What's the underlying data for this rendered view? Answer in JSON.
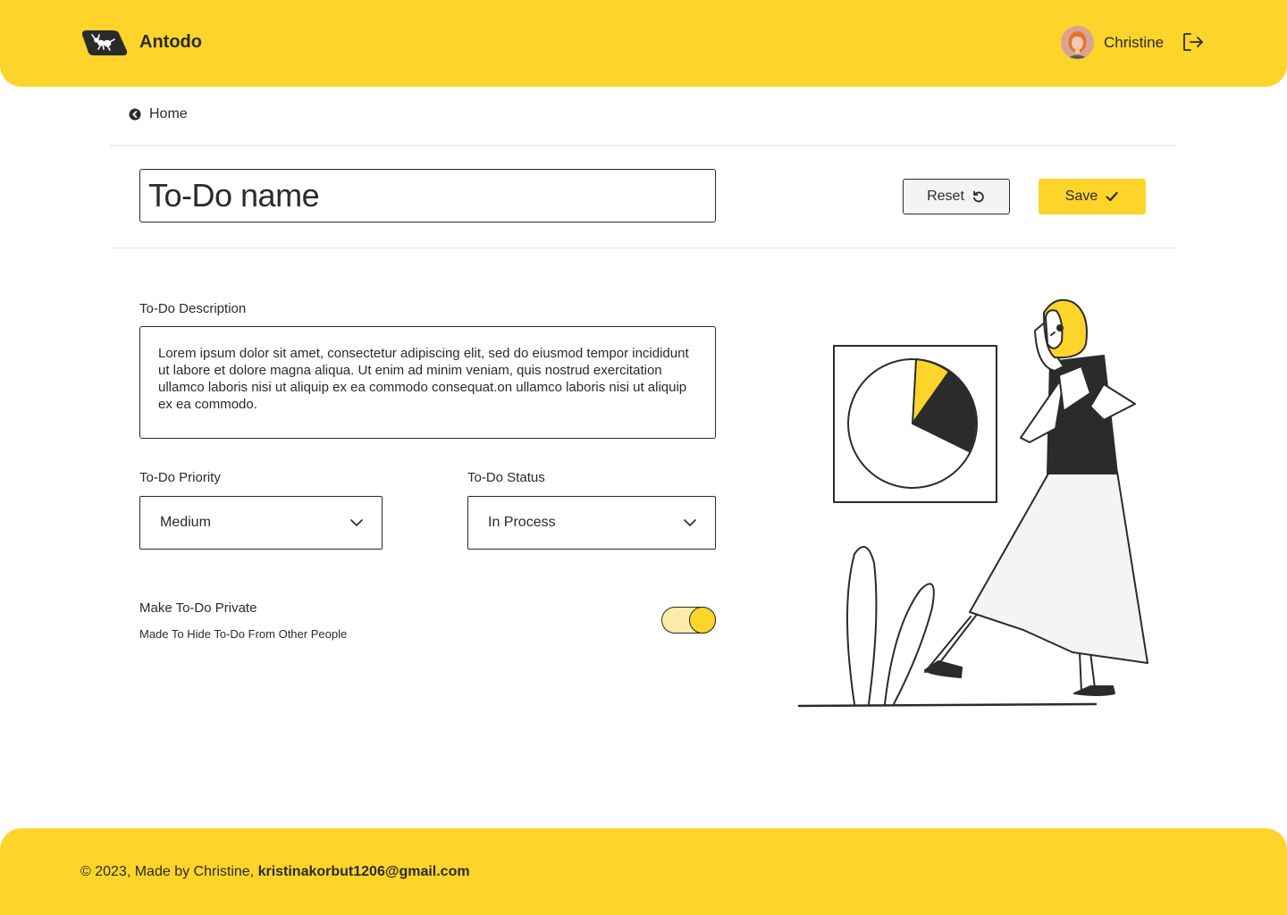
{
  "header": {
    "brand": "Antodo",
    "user_name": "Christine",
    "logo_icon": "ant-logo-icon",
    "logout_icon": "logout-icon"
  },
  "nav": {
    "back_label": "Home",
    "back_icon": "chevron-left-circle-icon"
  },
  "todo": {
    "name": "To-Do name",
    "reset_label": "Reset",
    "reset_icon": "refresh-icon",
    "save_label": "Save",
    "save_icon": "check-icon",
    "description_label": "To-Do Description",
    "description": "Lorem ipsum dolor sit amet, consectetur adipiscing elit, sed do eiusmod tempor incididunt ut labore et dolore magna aliqua. Ut enim ad minim veniam, quis nostrud exercitation ullamco laboris nisi ut aliquip ex ea commodo consequat.on ullamco laboris nisi ut aliquip ex ea commodo.",
    "priority_label": "To-Do Priority",
    "priority_value": "Medium",
    "status_label": "To-Do Status",
    "status_value": "In Process",
    "private_label": "Make To-Do Private",
    "private_hint": "Made To Hide To-Do From Other People",
    "private_enabled": true
  },
  "footer": {
    "copyright": "© 2023, Made by Christine, ",
    "email": "kristinakorbut1206@gmail.com"
  },
  "colors": {
    "accent": "#fdd42a",
    "text": "#2b2b2b",
    "toggle_track": "#fcecaa"
  }
}
